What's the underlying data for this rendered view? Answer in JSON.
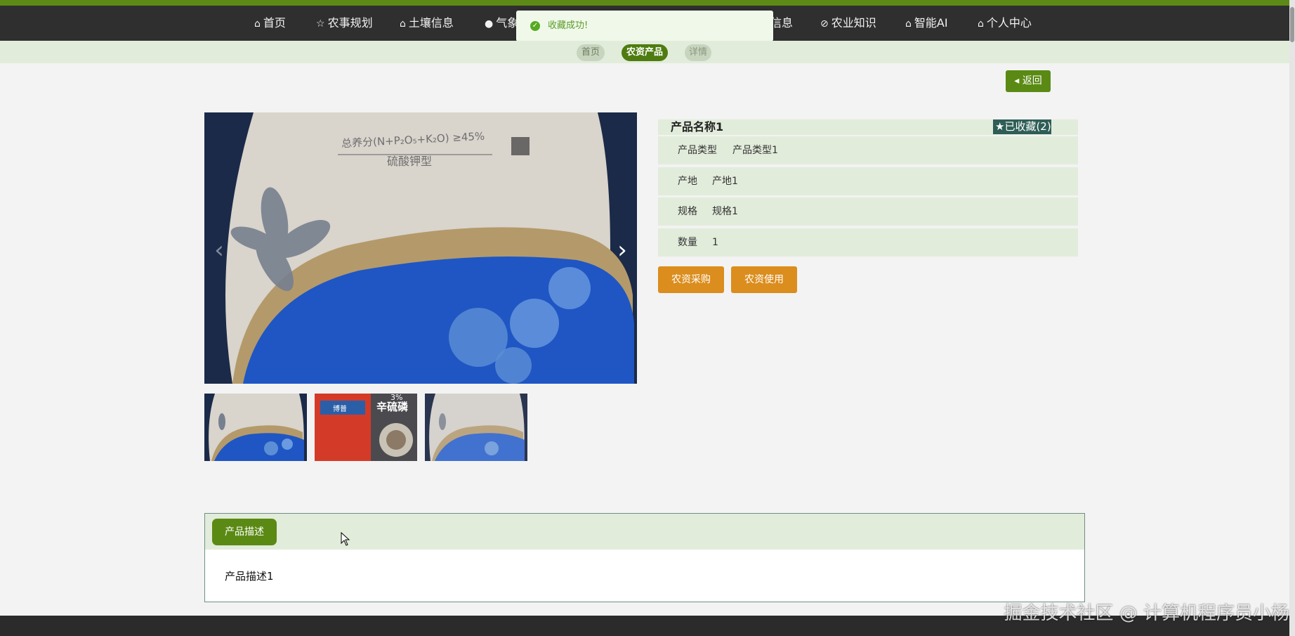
{
  "nav": {
    "items": [
      {
        "icon": "home-icon",
        "glyph": "⌂",
        "label": "首页"
      },
      {
        "icon": "star-icon",
        "glyph": "☆",
        "label": "农事规划"
      },
      {
        "icon": "lock-icon",
        "glyph": "⌂",
        "label": "土壤信息"
      },
      {
        "icon": "alert-icon",
        "glyph": "●",
        "label": "气象信息"
      },
      {
        "icon": "info-icon",
        "glyph": "",
        "label": "信息"
      },
      {
        "icon": "leaf-icon",
        "glyph": "⊘",
        "label": "农业知识"
      },
      {
        "icon": "home-icon",
        "glyph": "⌂",
        "label": "智能AI"
      },
      {
        "icon": "home-icon",
        "glyph": "⌂",
        "label": "个人中心"
      }
    ]
  },
  "toast": {
    "message": "收藏成功!",
    "icon": "check-circle-icon"
  },
  "breadcrumb": {
    "home": "首页",
    "category": "农资产品",
    "current": "详情"
  },
  "back_button": {
    "label": "返回",
    "icon": "caret-left-icon"
  },
  "product": {
    "name": "产品名称1",
    "favorite": {
      "label": "已收藏(2)",
      "icon": "star-icon"
    },
    "fields": [
      {
        "label": "产品类型",
        "value": "产品类型1"
      },
      {
        "label": "产地",
        "value": "产地1"
      },
      {
        "label": "规格",
        "value": "规格1"
      },
      {
        "label": "数量",
        "value": "1"
      }
    ]
  },
  "gallery": {
    "main_text": {
      "formula": "总养分(N+P₂O₅+K₂O) ≥45%",
      "type": "硫酸钾型"
    },
    "thumb2_text": {
      "percent": "3%",
      "title": "辛硫磷",
      "brand": "博普"
    },
    "prev_icon": "chevron-left-icon",
    "next_icon": "chevron-right-icon"
  },
  "actions": {
    "purchase": "农资采购",
    "use": "农资使用"
  },
  "description": {
    "tab": "产品描述",
    "content": "产品描述1"
  },
  "watermark": "掘金技术社区 @ 计算机程序员小杨",
  "colors": {
    "primary": "#5a8a14",
    "accent": "#db8d1d",
    "nav_bg": "#2f2f2f",
    "panel_bg": "#e2ecdb"
  }
}
